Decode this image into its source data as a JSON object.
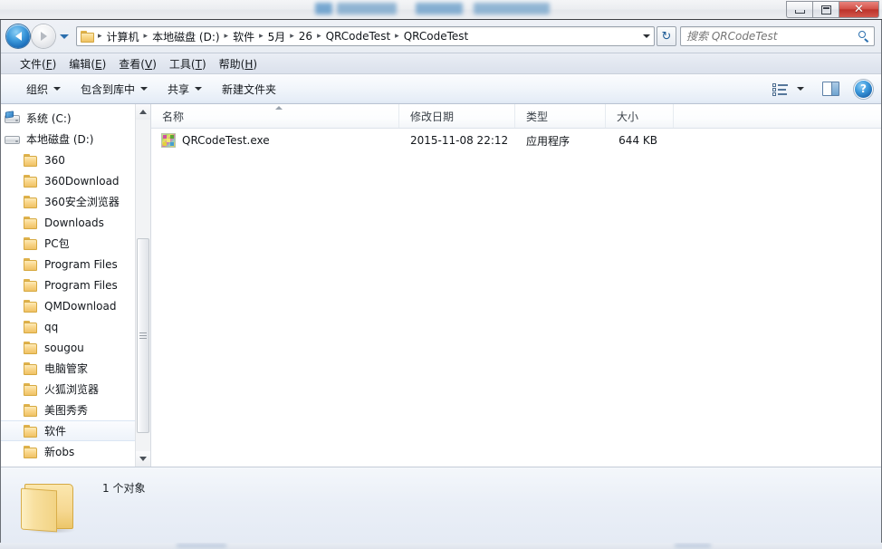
{
  "window": {
    "title_redacted": true,
    "controls": {
      "minimize": "minimize",
      "maximize": "restore",
      "close": "✕"
    }
  },
  "nav": {
    "back_tooltip": "后退",
    "forward_tooltip": "前进",
    "recent_dropdown": "最近浏览的位置",
    "breadcrumbs": [
      "计算机",
      "本地磁盘 (D:)",
      "软件",
      "5月",
      "26",
      "QRCodeTest",
      "QRCodeTest"
    ],
    "separator": "▸",
    "refresh_label": "↻",
    "search": {
      "value": "",
      "placeholder": "搜索 QRCodeTest"
    }
  },
  "menubar": {
    "items": [
      {
        "text": "文件",
        "accel": "F"
      },
      {
        "text": "编辑",
        "accel": "E"
      },
      {
        "text": "查看",
        "accel": "V"
      },
      {
        "text": "工具",
        "accel": "T"
      },
      {
        "text": "帮助",
        "accel": "H"
      }
    ]
  },
  "toolbar": {
    "organize": "组织",
    "include_in_library": "包含到库中",
    "share": "共享",
    "new_folder": "新建文件夹",
    "view_icon": "view-options-icon",
    "preview_pane_icon": "preview-pane-icon",
    "help_icon": "?"
  },
  "sidebar": {
    "items": [
      {
        "label": "系统 (C:)",
        "icon": "system-drive-icon",
        "indent": 0,
        "selected": false
      },
      {
        "label": "本地磁盘 (D:)",
        "icon": "drive-icon",
        "indent": 0,
        "selected": false
      },
      {
        "label": "360",
        "icon": "folder-icon",
        "indent": 1,
        "selected": false
      },
      {
        "label": "360Download",
        "icon": "folder-icon",
        "indent": 1,
        "selected": false
      },
      {
        "label": "360安全浏览器",
        "icon": "folder-icon",
        "indent": 1,
        "selected": false
      },
      {
        "label": "Downloads",
        "icon": "folder-icon",
        "indent": 1,
        "selected": false
      },
      {
        "label": "PC包",
        "icon": "folder-icon",
        "indent": 1,
        "selected": false
      },
      {
        "label": "Program Files",
        "icon": "folder-icon",
        "indent": 1,
        "selected": false
      },
      {
        "label": "Program Files",
        "icon": "folder-icon",
        "indent": 1,
        "selected": false
      },
      {
        "label": "QMDownload",
        "icon": "folder-icon",
        "indent": 1,
        "selected": false
      },
      {
        "label": "qq",
        "icon": "folder-icon",
        "indent": 1,
        "selected": false
      },
      {
        "label": "sougou",
        "icon": "folder-icon",
        "indent": 1,
        "selected": false
      },
      {
        "label": "电脑管家",
        "icon": "folder-icon",
        "indent": 1,
        "selected": false
      },
      {
        "label": "火狐浏览器",
        "icon": "folder-icon",
        "indent": 1,
        "selected": false
      },
      {
        "label": "美图秀秀",
        "icon": "folder-icon",
        "indent": 1,
        "selected": false
      },
      {
        "label": "软件",
        "icon": "folder-icon",
        "indent": 1,
        "selected": true
      },
      {
        "label": "新obs",
        "icon": "folder-icon",
        "indent": 1,
        "selected": false
      }
    ]
  },
  "filelist": {
    "columns": [
      {
        "key": "name",
        "label": "名称",
        "sorted": "asc"
      },
      {
        "key": "date",
        "label": "修改日期",
        "sorted": ""
      },
      {
        "key": "type",
        "label": "类型",
        "sorted": ""
      },
      {
        "key": "size",
        "label": "大小",
        "sorted": ""
      }
    ],
    "rows": [
      {
        "name": "QRCodeTest.exe",
        "date": "2015-11-08 22:12",
        "type": "应用程序",
        "size": "644 KB",
        "icon": "application-exe-icon"
      }
    ]
  },
  "details_pane": {
    "icon": "folder-large-icon",
    "status": "1 个对象"
  }
}
